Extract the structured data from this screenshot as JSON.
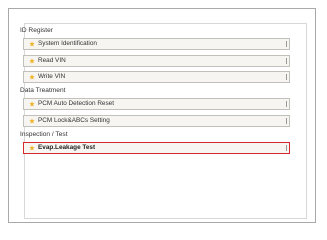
{
  "sections": [
    {
      "title": "ID Register",
      "items": [
        {
          "label": "System Identification"
        },
        {
          "label": "Read VIN"
        },
        {
          "label": "Write VIN"
        }
      ]
    },
    {
      "title": "Data Treatment",
      "items": [
        {
          "label": "PCM Auto Detection Reset"
        },
        {
          "label": "PCM Lock&ABCs Setting"
        }
      ]
    },
    {
      "title": "Inspection / Test",
      "items": [
        {
          "label": "Evap.Leakage Test"
        }
      ]
    }
  ],
  "selected_item": "Evap.Leakage Test",
  "colors": {
    "bullet": "#f0b428",
    "selected_border": "#d62a2a",
    "button_bg": "#f6f5f2"
  },
  "icons": {
    "bullet": "star-bullet-icon"
  }
}
